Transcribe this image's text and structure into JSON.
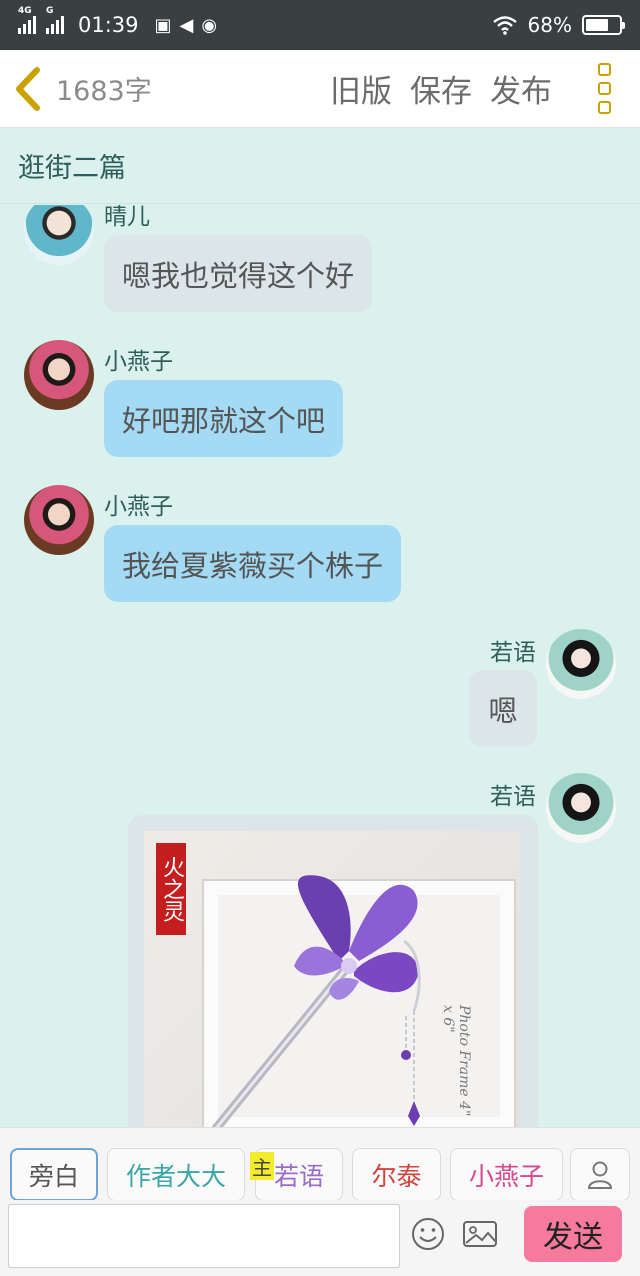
{
  "status_bar": {
    "net1": "4G",
    "net2": "G",
    "time": "01:39",
    "battery": "68%",
    "battery_level": 0.68
  },
  "header": {
    "word_count": "1683字",
    "old_version": "旧版",
    "save": "保存",
    "publish": "发布"
  },
  "chapter_title": "逛街二篇",
  "messages": [
    {
      "speaker": "晴儿",
      "text": "嗯我也觉得这个好"
    },
    {
      "speaker": "小燕子",
      "text": "好吧那就这个吧"
    },
    {
      "speaker": "小燕子",
      "text": "我给夏紫薇买个株子"
    },
    {
      "speaker": "若语",
      "text": "嗯"
    },
    {
      "speaker": "若语",
      "image_stamp": "火之灵",
      "image_frame_text": "Photo Frame 4\" x 6\""
    }
  ],
  "character_bar": {
    "chips": [
      "旁白",
      "作者大大",
      "若语",
      "尔泰",
      "小燕子"
    ],
    "main_mark": "主",
    "colors": {
      "narration": "#555555",
      "author": "#3aa6a6",
      "ruoyu": "#9a6cc9",
      "ertai": "#d0443c",
      "xiaoyanzi": "#d8468e"
    }
  },
  "input_bar": {
    "placeholder": "",
    "send_label": "发送"
  }
}
